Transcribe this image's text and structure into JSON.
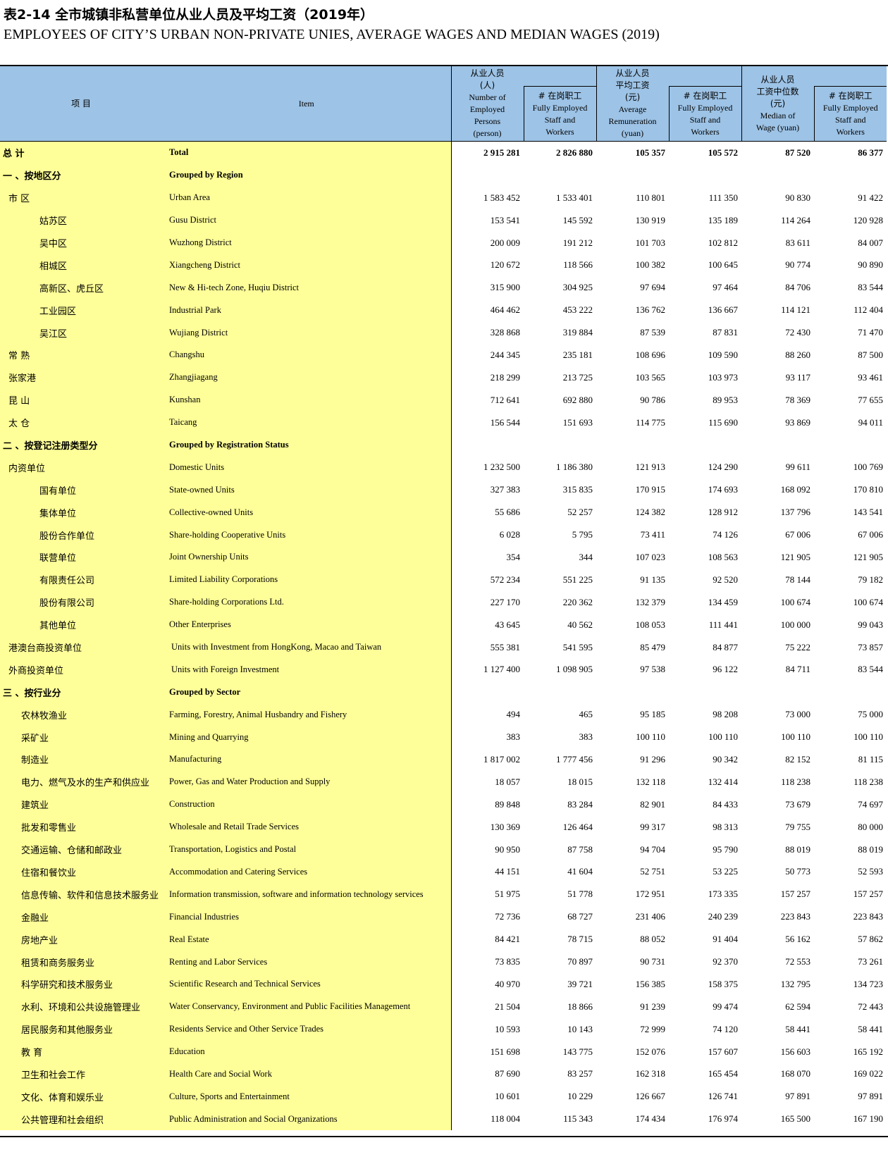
{
  "title_cn": "表2-14  全市城镇非私营单位从业人员及平均工资（2019年）",
  "title_en": "EMPLOYEES OF CITY’S URBAN NON-PRIVATE UNIES, AVERAGE WAGES AND MEDIAN WAGES (2019)",
  "header": {
    "item_cn": "项   目",
    "item_en": "Item",
    "groups": [
      {
        "cn": "从业人员",
        "cn2": "(人)",
        "en": [
          "Number of",
          "Employed",
          "Persons",
          "(person)"
        ]
      },
      {
        "cn": "从业人员",
        "cn2": "平均工资",
        "cn3": "(元)",
        "en": [
          "Average",
          "Remuneration",
          "(yuan)"
        ]
      },
      {
        "cn": "从业人员",
        "cn2": "工资中位数",
        "cn3": "(元)",
        "en": [
          "Median of",
          "Wage (yuan)"
        ]
      }
    ],
    "sub_cn": "# 在岗职工",
    "sub_en": [
      "Fully Employed",
      "Staff and",
      "Workers"
    ]
  },
  "rows": [
    {
      "cn": "总   计",
      "en": "Total",
      "lvl": "lvl0",
      "bold": true,
      "v": [
        "2 915 281",
        "2 826 880",
        "105 357",
        "105 572",
        "87 520",
        "86 377"
      ]
    },
    {
      "cn": "一 、按地区分",
      "en": "Grouped by Region",
      "lvl": "lvl0",
      "bold": true,
      "v": [
        "",
        "",
        "",
        "",
        "",
        ""
      ]
    },
    {
      "cn": "市  区",
      "en": "Urban Area",
      "lvl": "lvl1",
      "v": [
        "1 583 452",
        "1 533 401",
        "110 801",
        "111 350",
        "90 830",
        "91 422"
      ]
    },
    {
      "cn": "姑苏区",
      "en": "Gusu  District",
      "lvl": "lvl2",
      "v": [
        "153 541",
        "145 592",
        "130 919",
        "135 189",
        "114 264",
        "120 928"
      ]
    },
    {
      "cn": "吴中区",
      "en": "Wuzhong District",
      "lvl": "lvl2",
      "v": [
        "200 009",
        "191 212",
        "101 703",
        "102 812",
        "83 611",
        "84 007"
      ]
    },
    {
      "cn": "相城区",
      "en": "Xiangcheng District",
      "lvl": "lvl2",
      "v": [
        "120 672",
        "118 566",
        "100 382",
        "100 645",
        "90 774",
        "90 890"
      ]
    },
    {
      "cn": "高新区、虎丘区",
      "en": "New & Hi-tech Zone, Huqiu District",
      "lvl": "lvl2",
      "v": [
        "315 900",
        "304 925",
        "97 694",
        "97 464",
        "84 706",
        "83 544"
      ]
    },
    {
      "cn": "工业园区",
      "en": "Industrial Park",
      "lvl": "lvl2",
      "v": [
        "464 462",
        "453 222",
        "136 762",
        "136 667",
        "114 121",
        "112 404"
      ]
    },
    {
      "cn": "吴江区",
      "en": "Wujiang  District",
      "lvl": "lvl2",
      "v": [
        "328 868",
        "319 884",
        "87 539",
        "87 831",
        "72 430",
        "71 470"
      ]
    },
    {
      "cn": "常  熟",
      "en": "Changshu",
      "lvl": "lvl1",
      "v": [
        "244 345",
        "235 181",
        "108 696",
        "109 590",
        "88 260",
        "87 500"
      ]
    },
    {
      "cn": "张家港",
      "en": "Zhangjiagang",
      "lvl": "lvl1",
      "v": [
        "218 299",
        "213 725",
        "103 565",
        "103 973",
        "93 117",
        "93 461"
      ]
    },
    {
      "cn": "昆  山",
      "en": "Kunshan",
      "lvl": "lvl1",
      "v": [
        "712 641",
        "692 880",
        "90 786",
        "89 953",
        "78 369",
        "77 655"
      ]
    },
    {
      "cn": "太  仓",
      "en": "Taicang",
      "lvl": "lvl1",
      "v": [
        "156 544",
        "151 693",
        "114 775",
        "115 690",
        "93 869",
        "94 011"
      ]
    },
    {
      "cn": "二 、按登记注册类型分",
      "en": "Grouped by Registration Status",
      "lvl": "lvl0",
      "bold": true,
      "v": [
        "",
        "",
        "",
        "",
        "",
        ""
      ]
    },
    {
      "cn": "内资单位",
      "en": "Domestic Units",
      "lvl": "lvl1",
      "v": [
        "1 232 500",
        "1 186 380",
        "121 913",
        "124 290",
        "99 611",
        "100 769"
      ]
    },
    {
      "cn": "国有单位",
      "en": "State-owned Units",
      "lvl": "lvl2",
      "v": [
        "327 383",
        "315 835",
        "170 915",
        "174 693",
        "168 092",
        "170 810"
      ]
    },
    {
      "cn": "集体单位",
      "en": "Collective-owned Units",
      "lvl": "lvl2",
      "v": [
        "55 686",
        "52 257",
        "124 382",
        "128 912",
        "137 796",
        "143 541"
      ]
    },
    {
      "cn": "股份合作单位",
      "en": "Share-holding Cooperative Units",
      "lvl": "lvl2",
      "v": [
        "6 028",
        "5 795",
        "73 411",
        "74 126",
        "67 006",
        "67 006"
      ]
    },
    {
      "cn": "联营单位",
      "en": "Joint Ownership Units",
      "lvl": "lvl2",
      "v": [
        "354",
        "344",
        "107 023",
        "108 563",
        "121 905",
        "121 905"
      ]
    },
    {
      "cn": "有限责任公司",
      "en": "Limited Liability Corporations",
      "lvl": "lvl2",
      "v": [
        "572 234",
        "551 225",
        "91 135",
        "92 520",
        "78 144",
        "79 182"
      ]
    },
    {
      "cn": "股份有限公司",
      "en": "Share-holding Corporations Ltd.",
      "lvl": "lvl2",
      "v": [
        "227 170",
        "220 362",
        "132 379",
        "134 459",
        "100 674",
        "100 674"
      ]
    },
    {
      "cn": "其他单位",
      "en": "Other Enterprises",
      "lvl": "lvl2",
      "v": [
        "43 645",
        "40 562",
        "108 053",
        "111 441",
        "100 000",
        "99 043"
      ]
    },
    {
      "cn": "港澳台商投资单位",
      "en": "Units with Investment from HongKong, Macao and Taiwan",
      "lvl": "lvl1",
      "shift": true,
      "v": [
        "555 381",
        "541 595",
        "85 479",
        "84 877",
        "75 222",
        "73 857"
      ]
    },
    {
      "cn": "外商投资单位",
      "en": "Units with Foreign Investment",
      "lvl": "lvl1",
      "shift": true,
      "v": [
        "1 127 400",
        "1 098 905",
        "97 538",
        "96 122",
        "84 711",
        "83 544"
      ]
    },
    {
      "cn": "三 、按行业分",
      "en": "Grouped by Sector",
      "lvl": "lvl0",
      "bold": true,
      "v": [
        "",
        "",
        "",
        "",
        "",
        ""
      ]
    },
    {
      "cn": "农林牧渔业",
      "en": "Farming, Forestry, Animal Husbandry and Fishery",
      "lvl": "lvl1s",
      "v": [
        "494",
        "465",
        "95 185",
        "98 208",
        "73 000",
        "75 000"
      ]
    },
    {
      "cn": "采矿业",
      "en": "Mining and Quarrying",
      "lvl": "lvl1s",
      "v": [
        "383",
        "383",
        "100 110",
        "100 110",
        "100 110",
        "100 110"
      ]
    },
    {
      "cn": "制造业",
      "en": "Manufacturing",
      "lvl": "lvl1s",
      "v": [
        "1 817 002",
        "1 777 456",
        "91 296",
        "90 342",
        "82 152",
        "81 115"
      ]
    },
    {
      "cn": "电力、燃气及水的生产和供应业",
      "en": "Power, Gas and Water Production and Supply",
      "lvl": "lvl1s",
      "v": [
        "18 057",
        "18 015",
        "132 118",
        "132 414",
        "118 238",
        "118 238"
      ]
    },
    {
      "cn": "建筑业",
      "en": "Construction",
      "lvl": "lvl1s",
      "v": [
        "89 848",
        "83 284",
        "82 901",
        "84 433",
        "73 679",
        "74 697"
      ]
    },
    {
      "cn": "批发和零售业",
      "en": "Wholesale and Retail Trade Services",
      "lvl": "lvl1s",
      "v": [
        "130 369",
        "126 464",
        "99 317",
        "98 313",
        "79 755",
        "80 000"
      ]
    },
    {
      "cn": "交通运输、仓储和邮政业",
      "en": "Transportation, Logistics and Postal",
      "lvl": "lvl1s",
      "v": [
        "90 950",
        "87 758",
        "94 704",
        "95 790",
        "88 019",
        "88 019"
      ]
    },
    {
      "cn": "住宿和餐饮业",
      "en": "Accommodation  and Catering Services",
      "lvl": "lvl1s",
      "v": [
        "44 151",
        "41 604",
        "52 751",
        "53 225",
        "50 773",
        "52 593"
      ]
    },
    {
      "cn": "信息传输、软件和信息技术服务业",
      "en": "Information transmission, software and information technology services",
      "lvl": "lvl1s",
      "v": [
        "51 975",
        "51 778",
        "172 951",
        "173 335",
        "157 257",
        "157 257"
      ]
    },
    {
      "cn": "金融业",
      "en": "Financial Industries",
      "lvl": "lvl1s",
      "v": [
        "72 736",
        "68 727",
        "231 406",
        "240 239",
        "223 843",
        "223 843"
      ]
    },
    {
      "cn": "房地产业",
      "en": "Real Estate",
      "lvl": "lvl1s",
      "v": [
        "84 421",
        "78 715",
        "88 052",
        "91 404",
        "56 162",
        "57 862"
      ]
    },
    {
      "cn": "租赁和商务服务业",
      "en": "Renting and Labor Services",
      "lvl": "lvl1s",
      "v": [
        "73 835",
        "70 897",
        "90 731",
        "92 370",
        "72 553",
        "73 261"
      ]
    },
    {
      "cn": "科学研究和技术服务业",
      "en": "Scientific Research and Technical Services",
      "lvl": "lvl1s",
      "v": [
        "40 970",
        "39 721",
        "156 385",
        "158 375",
        "132 795",
        "134 723"
      ]
    },
    {
      "cn": "水利、环境和公共设施管理业",
      "en": "Water Conservancy, Environment and Public Facilities Management",
      "lvl": "lvl1s",
      "v": [
        "21 504",
        "18 866",
        "91 239",
        "99 474",
        "62 594",
        "72 443"
      ]
    },
    {
      "cn": "居民服务和其他服务业",
      "en": "Residents Service and Other Service Trades",
      "lvl": "lvl1s",
      "v": [
        "10 593",
        "10 143",
        "72 999",
        "74 120",
        "58 441",
        "58 441"
      ]
    },
    {
      "cn": "教  育",
      "en": "Education",
      "lvl": "lvl1s",
      "v": [
        "151 698",
        "143 775",
        "152 076",
        "157 607",
        "156 603",
        "165 192"
      ]
    },
    {
      "cn": "卫生和社会工作",
      "en": "Health Care and Social Work",
      "lvl": "lvl1s",
      "v": [
        "87 690",
        "83 257",
        "162 318",
        "165 454",
        "168 070",
        "169 022"
      ]
    },
    {
      "cn": "文化、体育和娱乐业",
      "en": "Culture, Sports and Entertainment",
      "lvl": "lvl1s",
      "v": [
        "10 601",
        "10 229",
        "126 667",
        "126 741",
        "97 891",
        "97 891"
      ]
    },
    {
      "cn": "公共管理和社会组织",
      "en": "Public Administration and Social Organizations",
      "lvl": "lvl1s",
      "v": [
        "118 004",
        "115 343",
        "174 434",
        "176 974",
        "165 500",
        "167 190"
      ]
    }
  ]
}
